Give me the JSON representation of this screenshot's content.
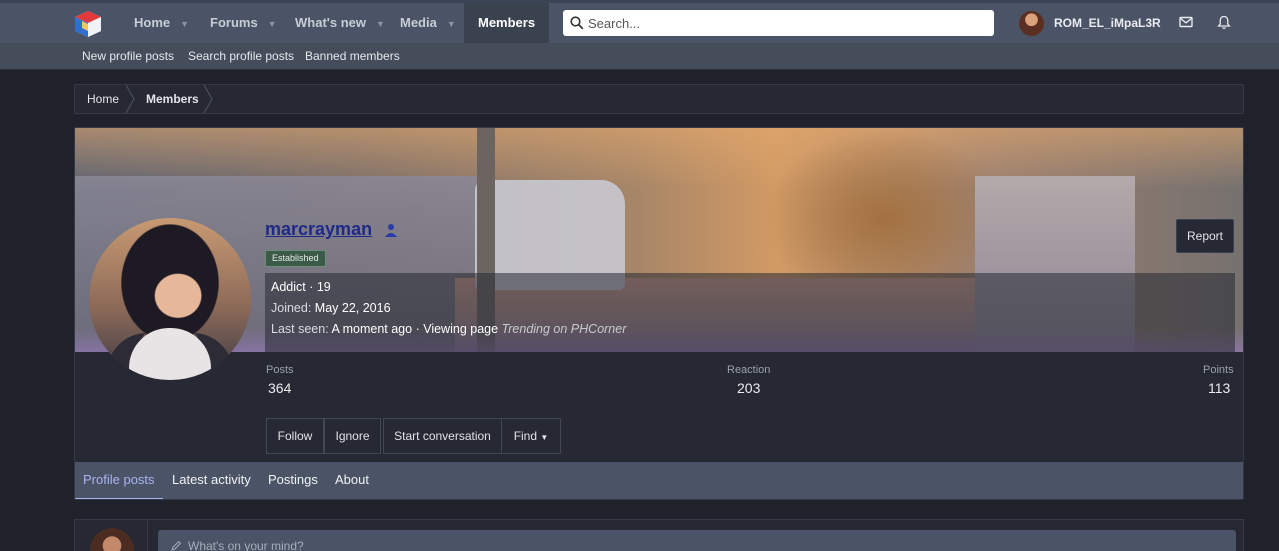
{
  "nav": {
    "items": [
      {
        "label": "Home",
        "has_caret": true
      },
      {
        "label": "Forums",
        "has_caret": true
      },
      {
        "label": "What's new",
        "has_caret": true
      },
      {
        "label": "Media",
        "has_caret": true
      },
      {
        "label": "Members",
        "has_caret": false,
        "active": true
      }
    ],
    "search_placeholder": "Search...",
    "user_name": "ROM_EL_iMpaL3R",
    "icons": [
      "inbox-icon",
      "bell-icon"
    ]
  },
  "subnav": {
    "links": [
      "New profile posts",
      "Search profile posts",
      "Banned members"
    ]
  },
  "breadcrumb": {
    "items": [
      "Home",
      "Members"
    ]
  },
  "profile": {
    "username": "marcrayman",
    "badge": "Established",
    "title_line": {
      "rank": "Addict",
      "separator": " · ",
      "level": "19"
    },
    "joined_label": "Joined:",
    "joined_value": "May 22, 2016",
    "last_seen_label": "Last seen:",
    "last_seen_value": "A moment ago",
    "last_seen_activity": "Viewing page",
    "last_seen_page": "Trending on PHCorner",
    "report_label": "Report",
    "stats": [
      {
        "label": "Posts",
        "value": "364"
      },
      {
        "label": "Reaction",
        "value": "203"
      },
      {
        "label": "Points",
        "value": "113"
      }
    ],
    "buttons": {
      "follow": "Follow",
      "ignore": "Ignore",
      "start_conversation": "Start conversation",
      "find": "Find"
    },
    "tabs": [
      "Profile posts",
      "Latest activity",
      "Postings",
      "About"
    ],
    "active_tab": "Profile posts"
  },
  "post": {
    "placeholder": "What's on your mind?"
  },
  "colors": {
    "nav_bg": "#4a5466",
    "page_bg": "#1f222b",
    "panel_bg": "#262933",
    "active_tab": "#a9b3f0",
    "username": "#1f2a88"
  }
}
